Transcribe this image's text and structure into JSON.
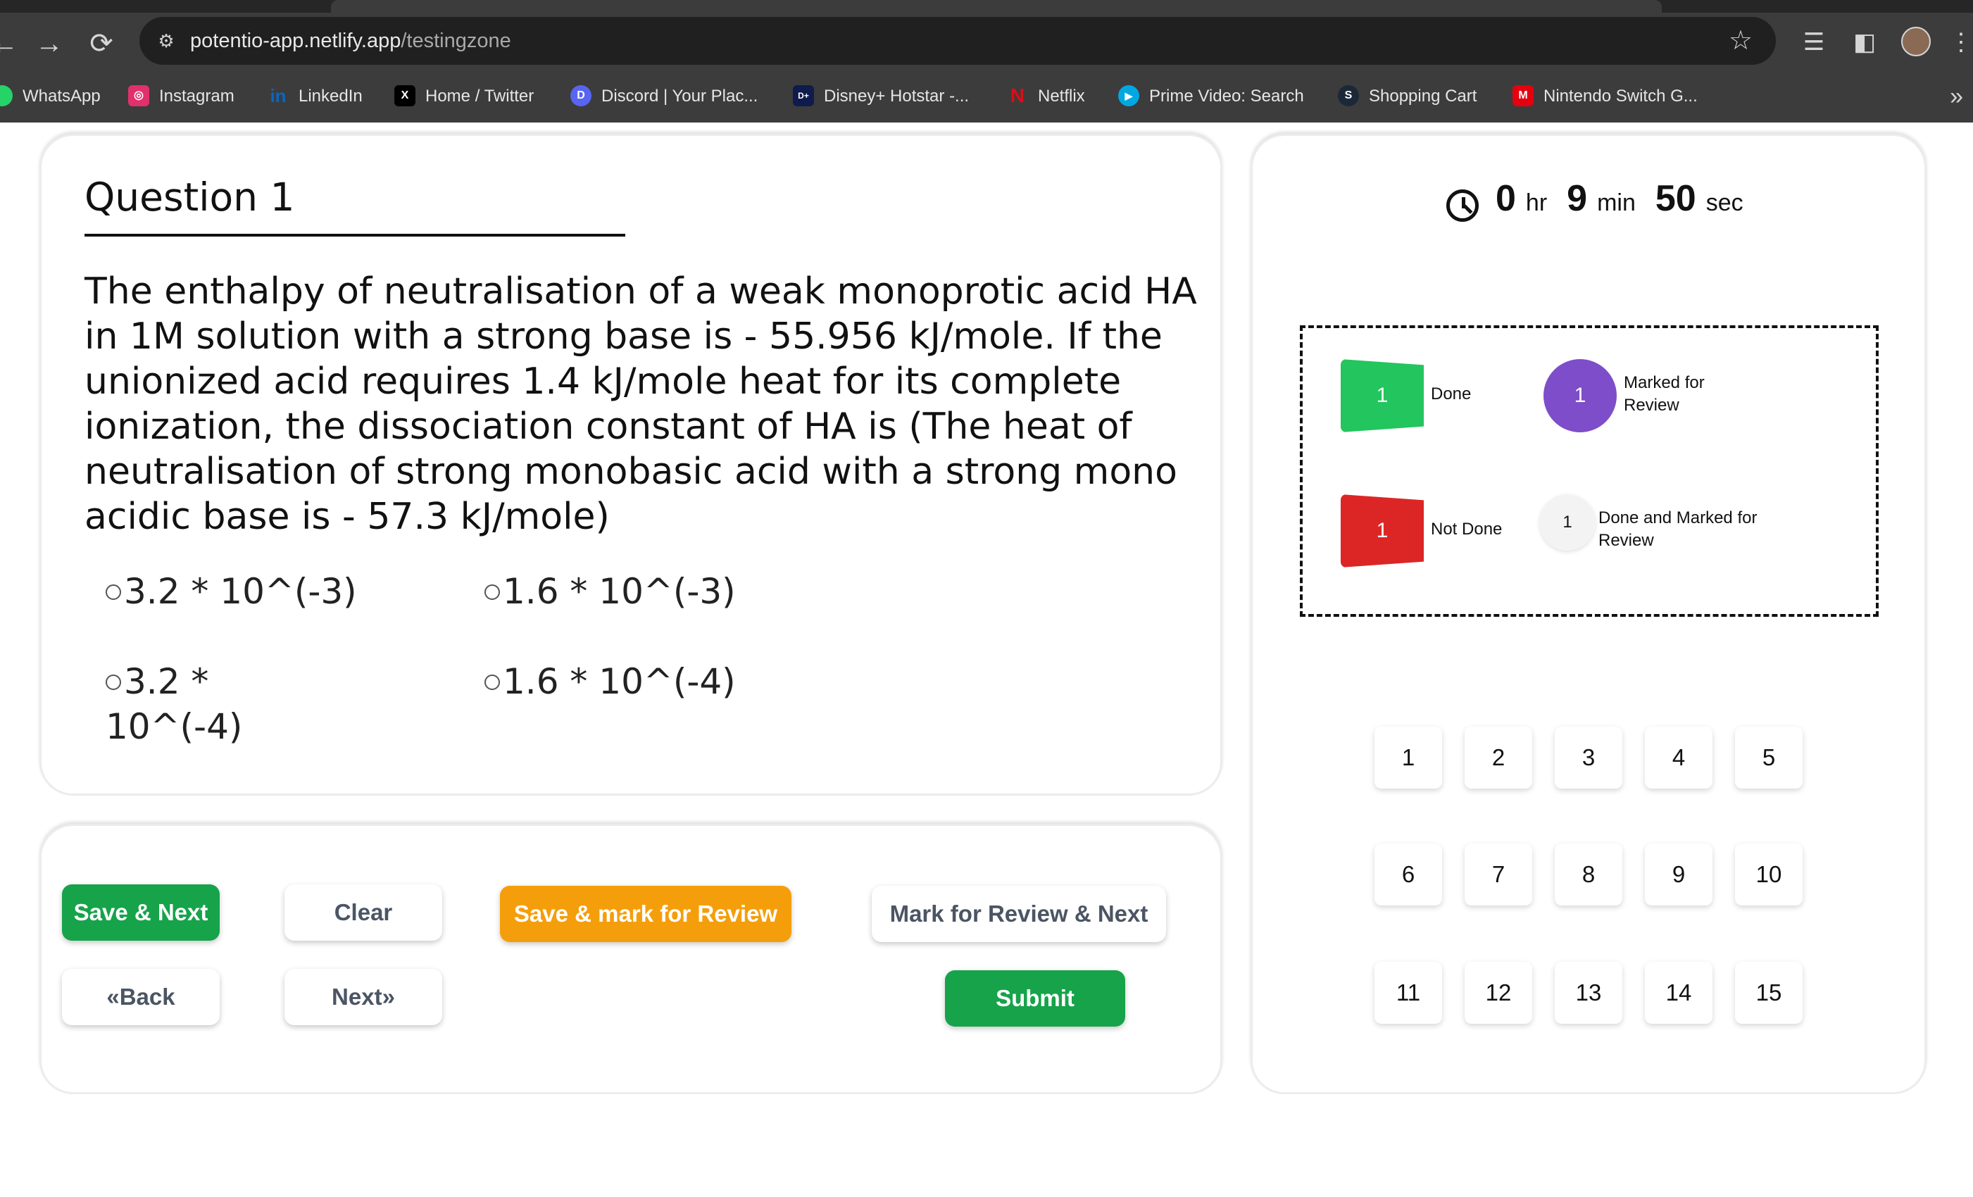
{
  "browser": {
    "url_domain": "potentio-app.netlify.app",
    "url_path": "/testingzone",
    "nav": {
      "back": "←",
      "forward": "→",
      "reload": "⟳"
    },
    "icons": {
      "site_info": "⚙",
      "star": "☆",
      "media": "☰",
      "sidepanel": "◧",
      "menu": "⋮",
      "more": "»"
    }
  },
  "bookmarks": [
    {
      "label": "WhatsApp",
      "icon": "whatsapp-icon",
      "color": "#25d366",
      "glyph": "W"
    },
    {
      "label": "Instagram",
      "icon": "instagram-icon",
      "color": "#e1306c",
      "glyph": "◎"
    },
    {
      "label": "LinkedIn",
      "icon": "linkedin-icon",
      "color": "#0a66c2",
      "glyph": "in"
    },
    {
      "label": "Home / Twitter",
      "icon": "x-twitter-icon",
      "color": "#000000",
      "glyph": "X"
    },
    {
      "label": "Discord | Your Plac...",
      "icon": "discord-icon",
      "color": "#5865f2",
      "glyph": "D"
    },
    {
      "label": "Disney+ Hotstar -...",
      "icon": "disney-hotstar-icon",
      "color": "#0f1b4c",
      "glyph": "D+"
    },
    {
      "label": "Netflix",
      "icon": "netflix-icon",
      "color": "#3c3c3c",
      "glyph": "N"
    },
    {
      "label": "Prime Video: Search",
      "icon": "prime-video-icon",
      "color": "#00a8e1",
      "glyph": "▶"
    },
    {
      "label": "Shopping Cart",
      "icon": "steam-icon",
      "color": "#1b2838",
      "glyph": "S"
    },
    {
      "label": "Nintendo Switch G...",
      "icon": "mario-icon",
      "color": "#e4000f",
      "glyph": "M"
    }
  ],
  "question": {
    "title": "Question 1",
    "text": "The enthalpy of neutralisation of a weak monoprotic acid HA in 1M solution with a strong base is - 55.956 kJ/mole. If the unionized acid requires 1.4 kJ/mole heat for its complete ionization, the dissociation constant of HA is (The heat of neutralisation of strong monobasic acid with a strong mono acidic base is - 57.3 kJ/mole)",
    "options": [
      "3.2 * 10^(-3)",
      "1.6 * 10^(-3)",
      "3.2 *",
      "10^(-4)",
      "1.6 * 10^(-4)"
    ]
  },
  "actions": {
    "save_next": "Save & Next",
    "clear": "Clear",
    "save_mark_review": "Save & mark for Review",
    "mark_review_next": "Mark for Review & Next",
    "back": "«Back",
    "next": "Next»",
    "submit": "Submit"
  },
  "timer": {
    "hours": "0",
    "hr_label": "hr",
    "minutes": "9",
    "min_label": "min",
    "seconds": "50",
    "sec_label": "sec"
  },
  "legend": {
    "done": {
      "count": "1",
      "label": "Done",
      "color": "#22c55e"
    },
    "marked": {
      "count": "1",
      "label": "Marked for Review",
      "color": "#7e4dc9"
    },
    "not_done": {
      "count": "1",
      "label": "Not Done",
      "color": "#dc2626"
    },
    "done_marked": {
      "count": "1",
      "label": "Done and Marked for Review",
      "color": "#f3f3f3"
    }
  },
  "question_numbers": [
    "1",
    "2",
    "3",
    "4",
    "5",
    "6",
    "7",
    "8",
    "9",
    "10",
    "11",
    "12",
    "13",
    "14",
    "15"
  ]
}
